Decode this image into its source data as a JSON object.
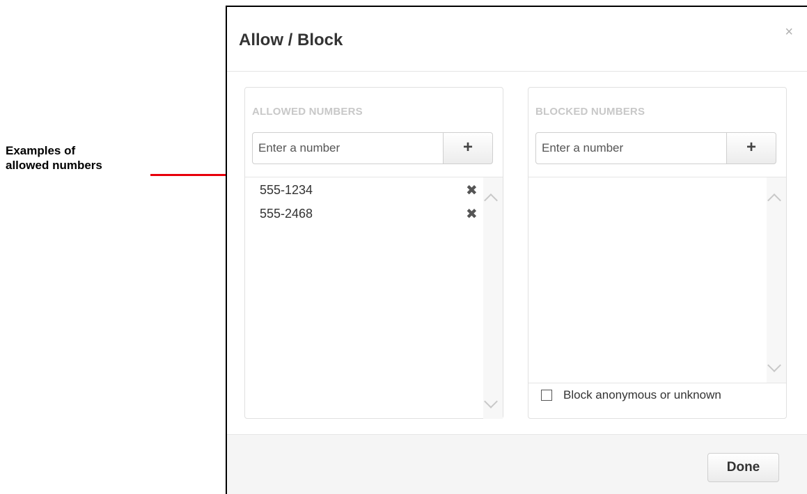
{
  "callout": {
    "text": "Examples of\nallowed numbers",
    "color": "#e8000b"
  },
  "dialog": {
    "title": "Allow / Block",
    "close_icon": "close-icon",
    "close_glyph": "×"
  },
  "allowed": {
    "heading": "ALLOWED NUMBERS",
    "input_placeholder": "Enter a number",
    "add_glyph": "+",
    "items": [
      {
        "number": "555-1234",
        "remove_glyph": "✖"
      },
      {
        "number": "555-2468",
        "remove_glyph": "✖"
      }
    ]
  },
  "blocked": {
    "heading": "BLOCKED NUMBERS",
    "input_placeholder": "Enter a number",
    "add_glyph": "+",
    "items": [],
    "anonymous_checkbox": {
      "label": "Block anonymous or unknown",
      "checked": false
    }
  },
  "footer": {
    "done_label": "Done"
  }
}
